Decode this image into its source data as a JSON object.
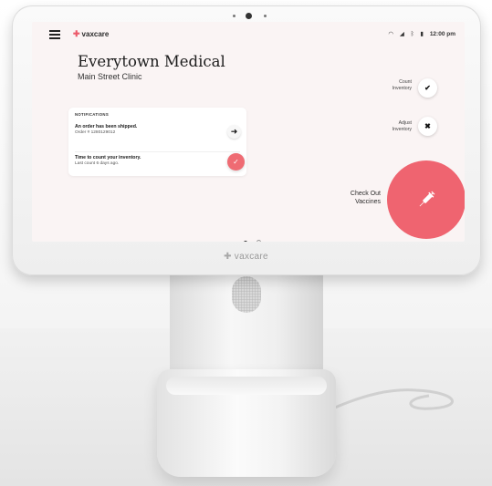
{
  "app": {
    "logo_text": "vaxcare",
    "bezel_logo_text": "vaxcare"
  },
  "status_bar": {
    "time": "12:00 pm",
    "icons": [
      "wifi-icon",
      "signal-icon",
      "bluetooth-icon",
      "battery-icon"
    ]
  },
  "header": {
    "clinic_name": "Everytown Medical",
    "location": "Main Street Clinic"
  },
  "notifications": {
    "heading": "NOTIFICATIONS",
    "items": [
      {
        "title": "An order has been shipped.",
        "subtitle": "Order # 1280129012",
        "action_icon": "arrow-right-icon"
      },
      {
        "title": "Time to count your inventory.",
        "subtitle": "Last count 6 days ago.",
        "action_icon": "check-icon"
      }
    ]
  },
  "actions": {
    "count_inventory": {
      "line1": "Count",
      "line2": "Inventory"
    },
    "adjust_inventory": {
      "line1": "Adjust",
      "line2": "Inventory"
    },
    "checkout": {
      "line1": "Check Out",
      "line2": "Vaccines"
    }
  },
  "pagination": {
    "current_page": 1,
    "total_pages": 2
  },
  "colors": {
    "accent": "#ef6470",
    "screen_bg": "#faf4f4",
    "card_bg": "#ffffff"
  }
}
